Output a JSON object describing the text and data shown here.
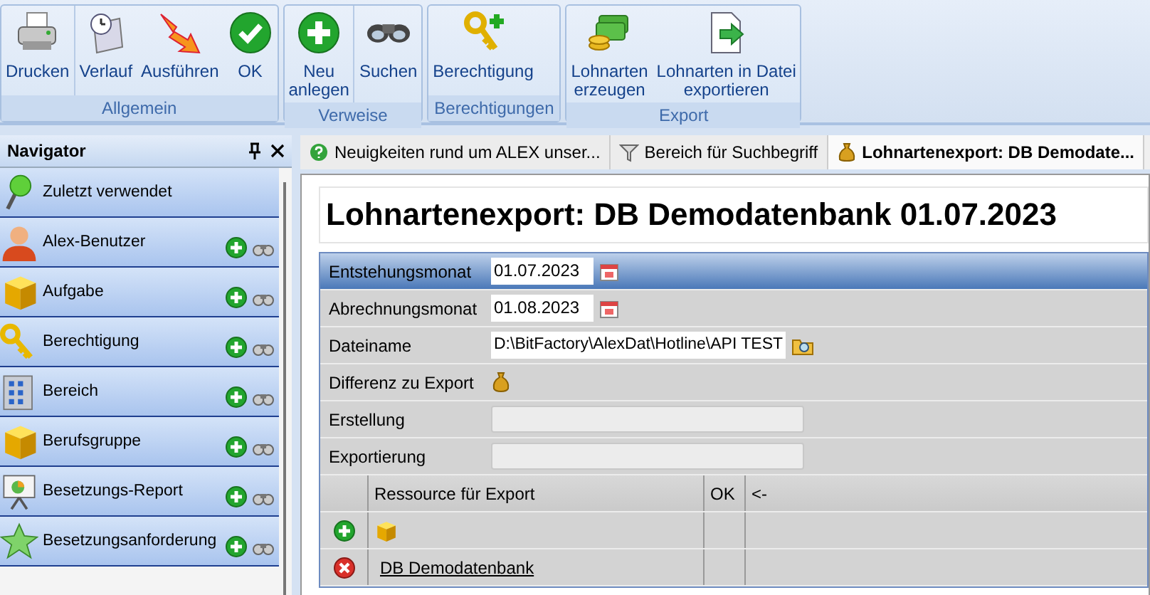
{
  "ribbon": {
    "groups": [
      {
        "label": "Allgemein",
        "buttons": [
          {
            "label": "Drucken",
            "separator": false
          },
          {
            "label": "Verlauf",
            "separator": true
          },
          {
            "label": "Ausführen",
            "separator": false
          },
          {
            "label": "OK",
            "separator": false
          }
        ]
      },
      {
        "label": "Verweise",
        "buttons": [
          {
            "label": "Neu\nanlegen",
            "separator": false
          },
          {
            "label": "Suchen",
            "separator": true
          }
        ]
      },
      {
        "label": "Berechtigungen",
        "buttons": [
          {
            "label": "Berechtigung",
            "separator": false
          }
        ]
      },
      {
        "label": "Export",
        "buttons": [
          {
            "label": "Lohnarten\nerzeugen",
            "separator": false
          },
          {
            "label": "Lohnarten in Datei\nexportieren",
            "separator": false
          }
        ]
      }
    ]
  },
  "navigator": {
    "title": "Navigator",
    "items": [
      {
        "label": "Zuletzt verwendet",
        "kind": "recent"
      },
      {
        "label": "Alex-Benutzer",
        "kind": "entity"
      },
      {
        "label": "Aufgabe",
        "kind": "entity"
      },
      {
        "label": "Berechtigung",
        "kind": "entity"
      },
      {
        "label": "Bereich",
        "kind": "entity"
      },
      {
        "label": "Berufsgruppe",
        "kind": "entity"
      },
      {
        "label": "Besetzungs-Report",
        "kind": "entity"
      },
      {
        "label": "Besetzungsanforderung",
        "kind": "entity"
      }
    ]
  },
  "tabs": [
    {
      "label": "Neuigkeiten rund um ALEX unser...",
      "selected": false
    },
    {
      "label": "Bereich für Suchbegriff",
      "selected": false
    },
    {
      "label": "Lohnartenexport: DB Demodate...",
      "selected": true
    }
  ],
  "title": "Lohnartenexport: DB Demodatenbank 01.07.2023",
  "form": [
    {
      "label": "Entstehungsmonat",
      "kind": "date",
      "value": "01.07.2023",
      "selected": true
    },
    {
      "label": "Abrechnungsmonat",
      "kind": "date",
      "value": "01.08.2023",
      "selected": false
    },
    {
      "label": "Dateiname",
      "kind": "file",
      "value": "D:\\BitFactory\\AlexDat\\Hotline\\API TEST",
      "selected": false
    },
    {
      "label": "Differenz zu Export",
      "kind": "icon",
      "selected": false
    },
    {
      "label": "Erstellung",
      "kind": "readonly",
      "selected": false
    },
    {
      "label": "Exportierung",
      "kind": "readonly",
      "selected": false
    }
  ],
  "table": {
    "columns": [
      "Ressource für Export",
      "OK",
      "<-"
    ],
    "rows": [
      {
        "kind": "new"
      },
      {
        "kind": "item",
        "resource": "DB Demodatenbank"
      }
    ]
  }
}
